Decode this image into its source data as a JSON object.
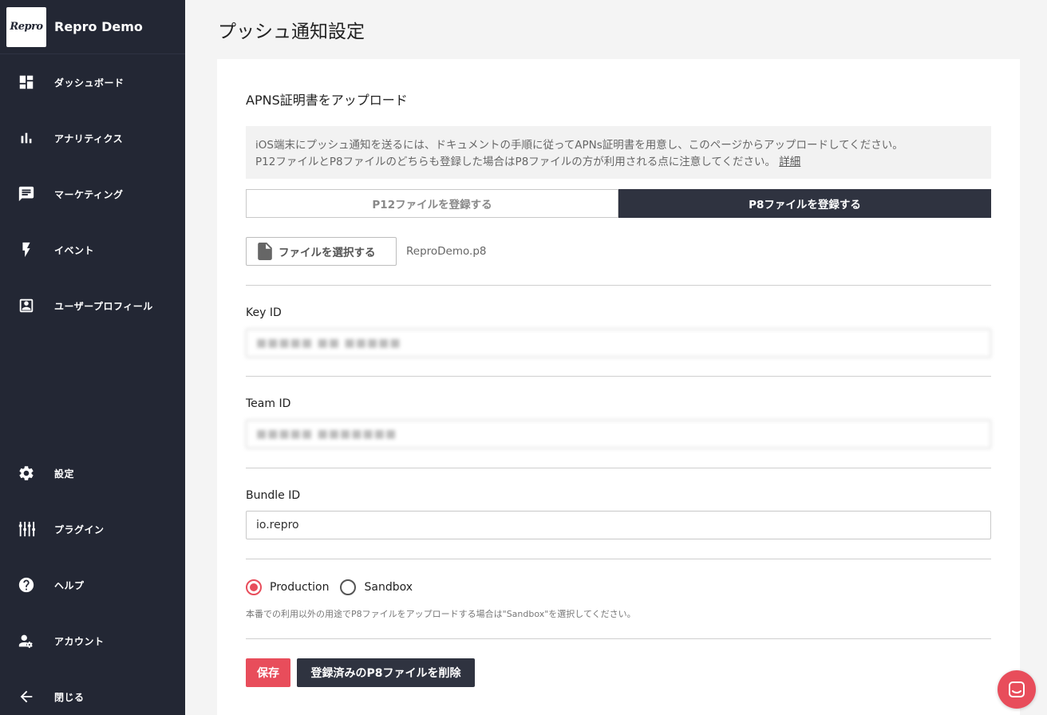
{
  "brand": {
    "logo_text": "Repro",
    "name": "Repro Demo"
  },
  "sidebar": {
    "items": [
      {
        "label": "ダッシュボード",
        "icon": "dashboard-icon"
      },
      {
        "label": "アナリティクス",
        "icon": "bar-chart-icon"
      },
      {
        "label": "マーケティング",
        "icon": "message-icon"
      },
      {
        "label": "イベント",
        "icon": "bolt-icon"
      },
      {
        "label": "ユーザープロフィール",
        "icon": "profile-icon"
      }
    ],
    "bottom_items": [
      {
        "label": "設定",
        "icon": "gear-icon"
      },
      {
        "label": "プラグイン",
        "icon": "plugin-icon"
      },
      {
        "label": "ヘルプ",
        "icon": "help-icon"
      },
      {
        "label": "アカウント",
        "icon": "account-settings-icon"
      },
      {
        "label": "閉じる",
        "icon": "arrow-left-icon"
      }
    ]
  },
  "page": {
    "title": "プッシュ通知設定"
  },
  "apns": {
    "section_title": "APNS証明書をアップロード",
    "notice_line1": "iOS端末にプッシュ通知を送るには、ドキュメントの手順に従ってAPNs証明書を用意し、このページからアップロードしてください。",
    "notice_line2": "P12ファイルとP8ファイルのどちらも登録した場合はP8ファイルの方が利用される点に注意してください。",
    "notice_link": "詳細",
    "tabs": [
      {
        "label": "P12ファイルを登録する",
        "selected": false
      },
      {
        "label": "P8ファイルを登録する",
        "selected": true
      }
    ],
    "file_button_label": "ファイルを選択する",
    "file_name": "ReproDemo.p8",
    "fields": {
      "key_id": {
        "label": "Key ID",
        "value": "■■■■■ ■■ ■■■■■"
      },
      "team_id": {
        "label": "Team ID",
        "value": "■■■■■ ■■■■■■■"
      },
      "bundle_id": {
        "label": "Bundle ID",
        "value": "io.repro"
      }
    },
    "environment": {
      "options": [
        {
          "label": "Production",
          "selected": true
        },
        {
          "label": "Sandbox",
          "selected": false
        }
      ],
      "help": "本番での利用以外の用途でP8ファイルをアップロードする場合は\"Sandbox\"を選択してください。"
    },
    "save_label": "保存",
    "delete_label": "登録済みのP8ファイルを削除"
  },
  "colors": {
    "sidebar_bg": "#232734",
    "accent": "#e84d5b",
    "dark_button": "#2f3340"
  }
}
